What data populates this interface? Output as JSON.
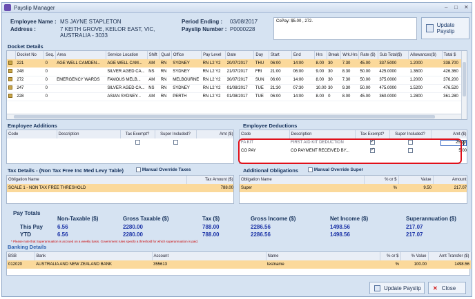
{
  "window": {
    "title": "Payslip Manager"
  },
  "header": {
    "employee_name_label": "Employee Name :",
    "employee_name": "MS JAYNE STAPLETON",
    "address_label": "Address :",
    "address_line1": "7 KEITH GROVE, KEILOR EAST, VIC,",
    "address_line2": "AUSTRALIA - 3033",
    "period_ending_label": "Period Ending :",
    "period_ending": "03/08/2017",
    "payslip_number_label": "Payslip Number :",
    "payslip_number": "P0000228",
    "copay_note": "CoPay: $5.00 , 272.",
    "update_payslip_label": "Update Payslip"
  },
  "docket": {
    "title": "Docket Details",
    "columns": [
      "Docket No",
      "Seq.",
      "Area",
      "Service Location",
      "Shift",
      "Qual",
      "Office",
      "Pay Level",
      "Date",
      "Day",
      "Start",
      "End",
      "Hrs",
      "Break",
      "Wrk.Hrs",
      "Rate ($)",
      "Sub Total($)",
      "Allowances($)",
      "Total $"
    ],
    "rows": [
      [
        "221",
        "0",
        "AGE WELL CAMDEN...",
        "AGE WELL CAM...",
        "AM",
        "RN",
        "SYDNEY",
        "RN L2 Y2",
        "20/07/2017",
        "THU",
        "06:00",
        "14:00",
        "8.00",
        "30",
        "7.30",
        "45.00",
        "337.5000",
        "1.2000",
        "338.700"
      ],
      [
        "248",
        "0",
        "",
        "SILVER AGED CA...",
        "NS",
        "RN",
        "SYDNEY",
        "RN L2 Y2",
        "21/07/2017",
        "FRI",
        "21:00",
        "06:00",
        "9.00",
        "30",
        "8.30",
        "50.00",
        "425.0000",
        "1.3600",
        "426.360"
      ],
      [
        "272",
        "0",
        "EMERGENCY WARDS",
        "FAMOUS MELB...",
        "AM",
        "RN",
        "MELBOURNE",
        "RN L2 Y2",
        "30/07/2017",
        "SUN",
        "06:00",
        "14:00",
        "8.00",
        "30",
        "7.30",
        "50.00",
        "375.0000",
        "1.2000",
        "376.200"
      ],
      [
        "247",
        "0",
        "",
        "SILVER AGED CA...",
        "NS",
        "RN",
        "SYDNEY",
        "RN L2 Y2",
        "01/08/2017",
        "TUE",
        "21:30",
        "07:30",
        "10.00",
        "30",
        "9.30",
        "50.00",
        "475.0000",
        "1.5200",
        "476.520"
      ],
      [
        "228",
        "0",
        "",
        "ASIAN SYDNEY...",
        "AM",
        "RN",
        "PERTH",
        "RN L2 Y2",
        "01/08/2017",
        "TUE",
        "06:00",
        "14:00",
        "8.00",
        "0",
        "8.00",
        "45.00",
        "360.0000",
        "1.2800",
        "361.280"
      ]
    ]
  },
  "additions": {
    "title": "Employee Additions",
    "columns": [
      "Code",
      "Description",
      "Tax Exempt?",
      "Super Included?",
      "Amt ($)"
    ]
  },
  "deductions": {
    "title": "Employee Deductions",
    "columns": [
      "Code",
      "Description",
      "Tax Exempt?",
      "Super Included?",
      "Amt ($)"
    ],
    "rows": [
      {
        "code": "FA KIT",
        "desc": "FIRST AID KIT DEDUCTION",
        "amt": "25.00"
      },
      {
        "code": "CO PAY",
        "desc": "CO PAYMENT RECEIVED BY...",
        "amt": "5.00"
      }
    ]
  },
  "tax": {
    "title": "Tax Details - (Non Tax Free Inc Med Levy Table)",
    "override": "Manual Override Taxes",
    "columns": [
      "Obligation Name",
      "Tax Amount ($)"
    ],
    "row": [
      "SCALE 1 - NON TAX FREE THRESHOLD",
      "788.00"
    ]
  },
  "obligations": {
    "title": "Additional Obligations",
    "override": "Manual Override Super",
    "columns": [
      "Obligation Name",
      "% or $",
      "Value",
      "Amount"
    ],
    "row": [
      "Super",
      "%",
      "9.50",
      "217.07"
    ]
  },
  "totals": {
    "title": "Pay Totals",
    "headers": [
      "Non-Taxable ($)",
      "Gross Taxable ($)",
      "Tax ($)",
      "Gross Income ($)",
      "Net Income ($)",
      "Superannuation ($)"
    ],
    "this_pay_label": "This Pay",
    "ytd_label": "YTD",
    "this_pay": [
      "6.56",
      "2280.00",
      "788.00",
      "2286.56",
      "1498.56",
      "217.07"
    ],
    "ytd": [
      "6.56",
      "2280.00",
      "788.00",
      "2286.56",
      "1498.56",
      "217.07"
    ],
    "note": "* Please note that Superannuation is accrued on a weekly basis. Government rules specify a threshold for which superannuation is paid."
  },
  "banking": {
    "title": "Banking Details",
    "columns": [
      "BSB",
      "Bank",
      "Account",
      "Name",
      "% or $",
      "% Value",
      "Amt Transfer ($)"
    ],
    "row": [
      "012020",
      "AUSTRALIA AND NEW ZEALAND BANK",
      "355613",
      "testname",
      "%",
      "100.00",
      "1498.56"
    ]
  },
  "footer": {
    "update_label": "Update Payslip",
    "close_label": "Close"
  }
}
